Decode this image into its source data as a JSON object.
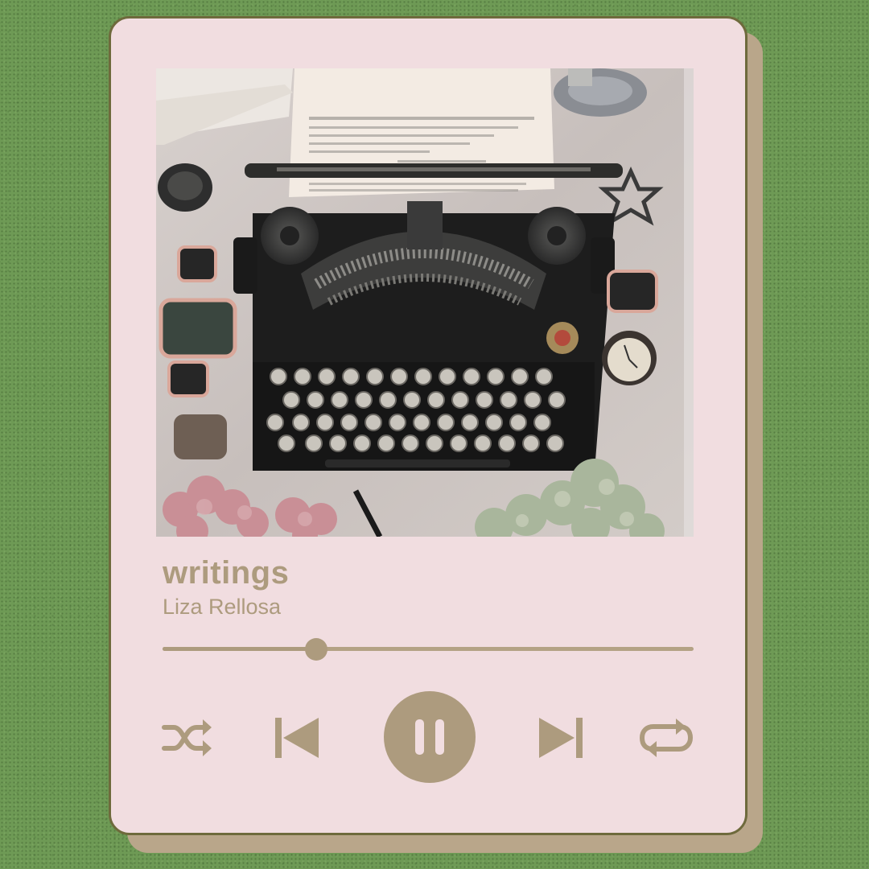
{
  "player": {
    "track_title": "writings",
    "artist": "Liza Rellosa",
    "progress_fraction": 0.29,
    "state": "playing"
  },
  "cover": {
    "description": "album artwork"
  },
  "controls": {
    "shuffle_icon": "shuffle-icon",
    "previous_icon": "skip-previous-icon",
    "pause_icon": "pause-icon",
    "next_icon": "skip-next-icon",
    "repeat_icon": "repeat-icon"
  },
  "colors": {
    "background": "#6e9a55",
    "card": "#f1dde0",
    "card_border": "#6e6a3c",
    "card_shadow": "#b9a68a",
    "accent": "#ad9b7e"
  }
}
